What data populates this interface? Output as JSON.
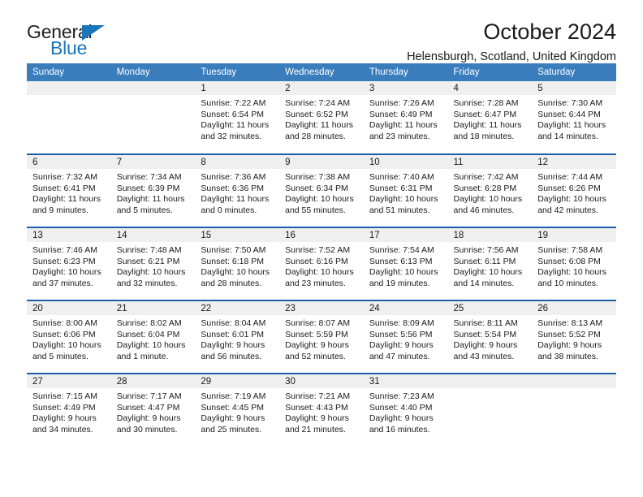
{
  "brand": {
    "name_part1": "General",
    "name_part2": "Blue",
    "accent_color": "#1b75bb"
  },
  "header": {
    "title": "October 2024",
    "subtitle": "Helensburgh, Scotland, United Kingdom"
  },
  "theme": {
    "header_row_color": "#3a7dbd",
    "row_border_color": "#1b5fa8",
    "day_band_color": "#efefef"
  },
  "weekdays": [
    "Sunday",
    "Monday",
    "Tuesday",
    "Wednesday",
    "Thursday",
    "Friday",
    "Saturday"
  ],
  "labels": {
    "sunrise": "Sunrise:",
    "sunset": "Sunset:",
    "daylight": "Daylight:"
  },
  "weeks": [
    [
      {
        "day": "",
        "sunrise": "",
        "sunset": "",
        "daylight": ""
      },
      {
        "day": "",
        "sunrise": "",
        "sunset": "",
        "daylight": ""
      },
      {
        "day": "1",
        "sunrise": "Sunrise: 7:22 AM",
        "sunset": "Sunset: 6:54 PM",
        "daylight": "Daylight: 11 hours and 32 minutes."
      },
      {
        "day": "2",
        "sunrise": "Sunrise: 7:24 AM",
        "sunset": "Sunset: 6:52 PM",
        "daylight": "Daylight: 11 hours and 28 minutes."
      },
      {
        "day": "3",
        "sunrise": "Sunrise: 7:26 AM",
        "sunset": "Sunset: 6:49 PM",
        "daylight": "Daylight: 11 hours and 23 minutes."
      },
      {
        "day": "4",
        "sunrise": "Sunrise: 7:28 AM",
        "sunset": "Sunset: 6:47 PM",
        "daylight": "Daylight: 11 hours and 18 minutes."
      },
      {
        "day": "5",
        "sunrise": "Sunrise: 7:30 AM",
        "sunset": "Sunset: 6:44 PM",
        "daylight": "Daylight: 11 hours and 14 minutes."
      }
    ],
    [
      {
        "day": "6",
        "sunrise": "Sunrise: 7:32 AM",
        "sunset": "Sunset: 6:41 PM",
        "daylight": "Daylight: 11 hours and 9 minutes."
      },
      {
        "day": "7",
        "sunrise": "Sunrise: 7:34 AM",
        "sunset": "Sunset: 6:39 PM",
        "daylight": "Daylight: 11 hours and 5 minutes."
      },
      {
        "day": "8",
        "sunrise": "Sunrise: 7:36 AM",
        "sunset": "Sunset: 6:36 PM",
        "daylight": "Daylight: 11 hours and 0 minutes."
      },
      {
        "day": "9",
        "sunrise": "Sunrise: 7:38 AM",
        "sunset": "Sunset: 6:34 PM",
        "daylight": "Daylight: 10 hours and 55 minutes."
      },
      {
        "day": "10",
        "sunrise": "Sunrise: 7:40 AM",
        "sunset": "Sunset: 6:31 PM",
        "daylight": "Daylight: 10 hours and 51 minutes."
      },
      {
        "day": "11",
        "sunrise": "Sunrise: 7:42 AM",
        "sunset": "Sunset: 6:28 PM",
        "daylight": "Daylight: 10 hours and 46 minutes."
      },
      {
        "day": "12",
        "sunrise": "Sunrise: 7:44 AM",
        "sunset": "Sunset: 6:26 PM",
        "daylight": "Daylight: 10 hours and 42 minutes."
      }
    ],
    [
      {
        "day": "13",
        "sunrise": "Sunrise: 7:46 AM",
        "sunset": "Sunset: 6:23 PM",
        "daylight": "Daylight: 10 hours and 37 minutes."
      },
      {
        "day": "14",
        "sunrise": "Sunrise: 7:48 AM",
        "sunset": "Sunset: 6:21 PM",
        "daylight": "Daylight: 10 hours and 32 minutes."
      },
      {
        "day": "15",
        "sunrise": "Sunrise: 7:50 AM",
        "sunset": "Sunset: 6:18 PM",
        "daylight": "Daylight: 10 hours and 28 minutes."
      },
      {
        "day": "16",
        "sunrise": "Sunrise: 7:52 AM",
        "sunset": "Sunset: 6:16 PM",
        "daylight": "Daylight: 10 hours and 23 minutes."
      },
      {
        "day": "17",
        "sunrise": "Sunrise: 7:54 AM",
        "sunset": "Sunset: 6:13 PM",
        "daylight": "Daylight: 10 hours and 19 minutes."
      },
      {
        "day": "18",
        "sunrise": "Sunrise: 7:56 AM",
        "sunset": "Sunset: 6:11 PM",
        "daylight": "Daylight: 10 hours and 14 minutes."
      },
      {
        "day": "19",
        "sunrise": "Sunrise: 7:58 AM",
        "sunset": "Sunset: 6:08 PM",
        "daylight": "Daylight: 10 hours and 10 minutes."
      }
    ],
    [
      {
        "day": "20",
        "sunrise": "Sunrise: 8:00 AM",
        "sunset": "Sunset: 6:06 PM",
        "daylight": "Daylight: 10 hours and 5 minutes."
      },
      {
        "day": "21",
        "sunrise": "Sunrise: 8:02 AM",
        "sunset": "Sunset: 6:04 PM",
        "daylight": "Daylight: 10 hours and 1 minute."
      },
      {
        "day": "22",
        "sunrise": "Sunrise: 8:04 AM",
        "sunset": "Sunset: 6:01 PM",
        "daylight": "Daylight: 9 hours and 56 minutes."
      },
      {
        "day": "23",
        "sunrise": "Sunrise: 8:07 AM",
        "sunset": "Sunset: 5:59 PM",
        "daylight": "Daylight: 9 hours and 52 minutes."
      },
      {
        "day": "24",
        "sunrise": "Sunrise: 8:09 AM",
        "sunset": "Sunset: 5:56 PM",
        "daylight": "Daylight: 9 hours and 47 minutes."
      },
      {
        "day": "25",
        "sunrise": "Sunrise: 8:11 AM",
        "sunset": "Sunset: 5:54 PM",
        "daylight": "Daylight: 9 hours and 43 minutes."
      },
      {
        "day": "26",
        "sunrise": "Sunrise: 8:13 AM",
        "sunset": "Sunset: 5:52 PM",
        "daylight": "Daylight: 9 hours and 38 minutes."
      }
    ],
    [
      {
        "day": "27",
        "sunrise": "Sunrise: 7:15 AM",
        "sunset": "Sunset: 4:49 PM",
        "daylight": "Daylight: 9 hours and 34 minutes."
      },
      {
        "day": "28",
        "sunrise": "Sunrise: 7:17 AM",
        "sunset": "Sunset: 4:47 PM",
        "daylight": "Daylight: 9 hours and 30 minutes."
      },
      {
        "day": "29",
        "sunrise": "Sunrise: 7:19 AM",
        "sunset": "Sunset: 4:45 PM",
        "daylight": "Daylight: 9 hours and 25 minutes."
      },
      {
        "day": "30",
        "sunrise": "Sunrise: 7:21 AM",
        "sunset": "Sunset: 4:43 PM",
        "daylight": "Daylight: 9 hours and 21 minutes."
      },
      {
        "day": "31",
        "sunrise": "Sunrise: 7:23 AM",
        "sunset": "Sunset: 4:40 PM",
        "daylight": "Daylight: 9 hours and 16 minutes."
      },
      {
        "day": "",
        "sunrise": "",
        "sunset": "",
        "daylight": ""
      },
      {
        "day": "",
        "sunrise": "",
        "sunset": "",
        "daylight": ""
      }
    ]
  ]
}
